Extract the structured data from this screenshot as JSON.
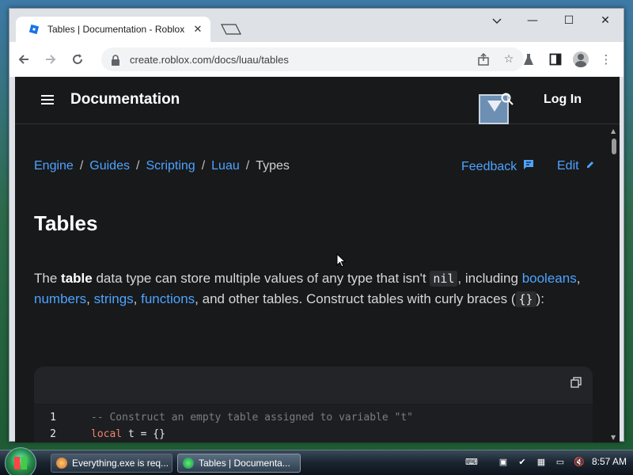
{
  "browser": {
    "tab_title": "Tables | Documentation - Roblox",
    "tab_close": "✕",
    "url": "create.roblox.com/docs/luau/tables",
    "window_controls": {
      "minimize": "—",
      "maximize": "☐",
      "close": "✕"
    }
  },
  "site": {
    "title": "Documentation",
    "login": "Log In"
  },
  "breadcrumb": {
    "items": [
      "Engine",
      "Guides",
      "Scripting",
      "Luau"
    ],
    "separator": "/",
    "current": "Types"
  },
  "actions": {
    "feedback": "Feedback",
    "edit": "Edit"
  },
  "page": {
    "title": "Tables",
    "intro": {
      "p1": "The ",
      "bold": "table",
      "p2": " data type can store multiple values of any type that isn't ",
      "code_nil": "nil",
      "p3": ", including ",
      "link_booleans": "booleans",
      "c1": ", ",
      "link_numbers": "numbers",
      "c2": ", ",
      "link_strings": "strings",
      "c3": ", ",
      "link_functions": "functions",
      "p4": ", and other tables. Construct tables with curly braces (",
      "code_braces": "{}",
      "p5": "):"
    }
  },
  "code": {
    "lines": [
      {
        "num": "1",
        "comment": "-- Construct an empty table assigned to variable \"t\""
      },
      {
        "num": "2",
        "keyword": "local",
        "rest": " t = {}"
      }
    ]
  },
  "taskbar": {
    "tasks": [
      {
        "label": "Everything.exe is req..."
      },
      {
        "label": "Tables | Documenta..."
      }
    ],
    "clock": "8:57 AM"
  },
  "colors": {
    "page_bg": "#18191b",
    "link": "#4da3ff",
    "keyword": "#f0846a"
  }
}
